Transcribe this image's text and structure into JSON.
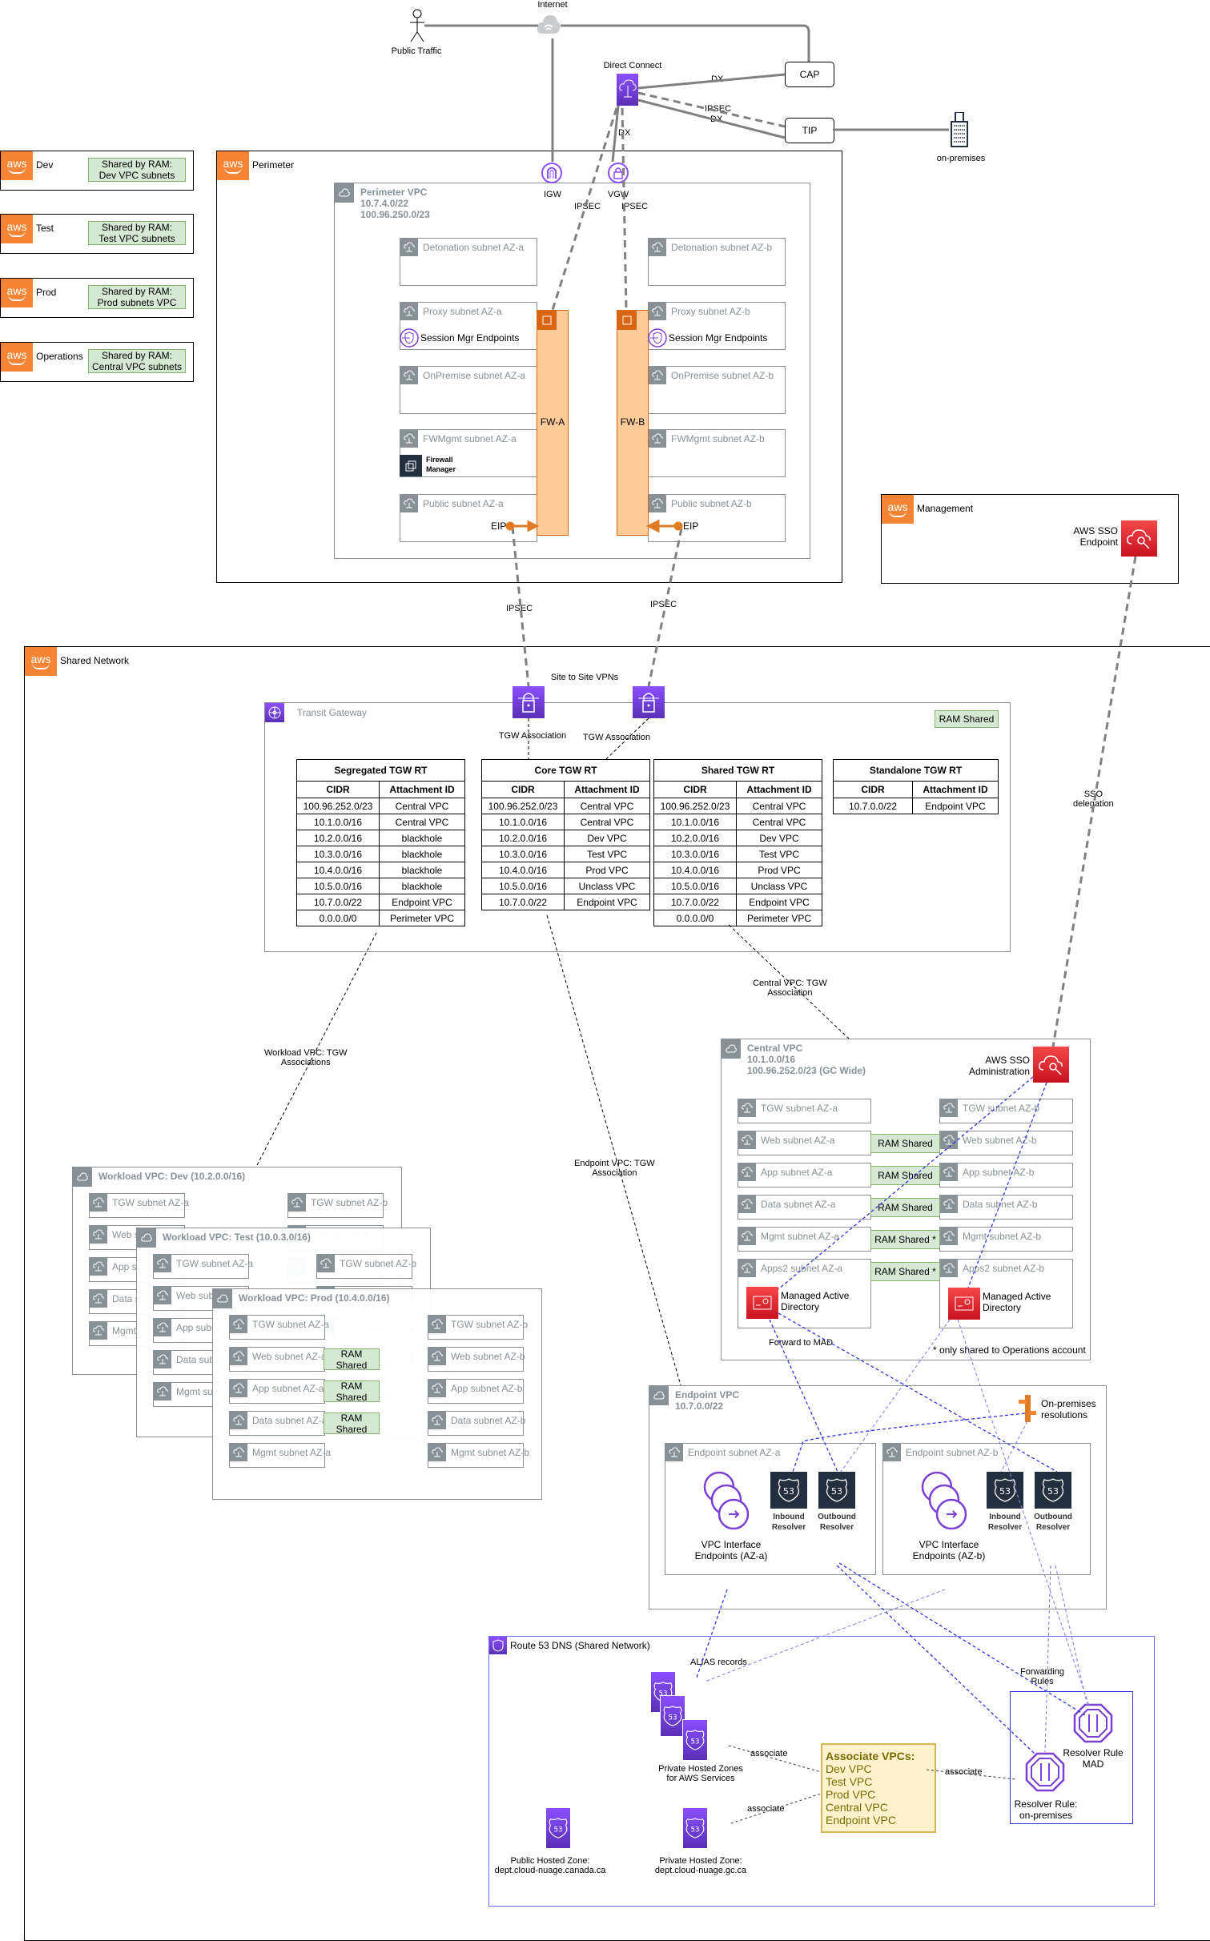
{
  "top": {
    "public_traffic": "Public Traffic",
    "internet": "Internet",
    "direct_connect": "Direct Connect",
    "cap": "CAP",
    "tip": "TIP",
    "on_premises": "on-premises",
    "dx1": "DX",
    "ipsec": "IPSEC",
    "dx2": "DX",
    "dx3": "DX",
    "igw": "IGW",
    "vgw": "VGW",
    "ipsec_a": "IPSEC",
    "ipsec_b": "IPSEC"
  },
  "accounts": [
    {
      "name": "Dev",
      "ram": "Shared by RAM:\nDev VPC subnets"
    },
    {
      "name": "Test",
      "ram": "Shared by RAM:\nTest VPC subnets"
    },
    {
      "name": "Prod",
      "ram": "Shared by RAM:\nProd subnets VPC"
    },
    {
      "name": "Operations",
      "ram": "Shared by RAM:\nCentral VPC subnets"
    }
  ],
  "aws_logo": "aws",
  "perimeter": {
    "account": "Perimeter",
    "vpc_title": "Perimeter VPC\n10.7.4.0/22\n100.96.250.0/23",
    "subnets_a": [
      "Detonation subnet AZ-a",
      "Proxy subnet AZ-a",
      "OnPremise subnet AZ-a",
      "FWMgmt subnet AZ-a",
      "Public subnet AZ-a"
    ],
    "subnets_b": [
      "Detonation subnet AZ-b",
      "Proxy subnet AZ-b",
      "OnPremise subnet AZ-b",
      "FWMgmt subnet AZ-b",
      "Public subnet AZ-b"
    ],
    "session_mgr": "Session Mgr Endpoints",
    "firewall_manager": "Firewall\nManager",
    "fw_a": "FW-A",
    "fw_b": "FW-B",
    "eip": "EIP",
    "ipsec_down": "IPSEC"
  },
  "management": {
    "account": "Management",
    "sso_endpoint": "AWS SSO\nEndpoint",
    "sso_delegation": "SSO\ndelegation"
  },
  "shared_network": {
    "account": "Shared Network",
    "site_to_site": "Site to Site VPNs",
    "tgw_association": "TGW Association",
    "transit_gateway": "Transit Gateway",
    "ram_shared": "RAM Shared",
    "route_tables": [
      {
        "title": "Segregated TGW RT",
        "headers": [
          "CIDR",
          "Attachment ID"
        ],
        "rows": [
          [
            "100.96.252.0/23",
            "Central VPC"
          ],
          [
            "10.1.0.0/16",
            "Central VPC"
          ],
          [
            "10.2.0.0/16",
            "blackhole"
          ],
          [
            "10.3.0.0/16",
            "blackhole"
          ],
          [
            "10.4.0.0/16",
            "blackhole"
          ],
          [
            "10.5.0.0/16",
            "blackhole"
          ],
          [
            "10.7.0.0/22",
            "Endpoint VPC"
          ],
          [
            "0.0.0.0/0",
            "Perimeter VPC"
          ]
        ]
      },
      {
        "title": "Core TGW RT",
        "headers": [
          "CIDR",
          "Attachment ID"
        ],
        "rows": [
          [
            "100.96.252.0/23",
            "Central VPC"
          ],
          [
            "10.1.0.0/16",
            "Central VPC"
          ],
          [
            "10.2.0.0/16",
            "Dev VPC"
          ],
          [
            "10.3.0.0/16",
            "Test VPC"
          ],
          [
            "10.4.0.0/16",
            "Prod VPC"
          ],
          [
            "10.5.0.0/16",
            "Unclass VPC"
          ],
          [
            "10.7.0.0/22",
            "Endpoint VPC"
          ]
        ]
      },
      {
        "title": "Shared TGW RT",
        "headers": [
          "CIDR",
          "Attachment ID"
        ],
        "rows": [
          [
            "100.96.252.0/23",
            "Central VPC"
          ],
          [
            "10.1.0.0/16",
            "Central VPC"
          ],
          [
            "10.2.0.0/16",
            "Dev VPC"
          ],
          [
            "10.3.0.0/16",
            "Test VPC"
          ],
          [
            "10.4.0.0/16",
            "Prod VPC"
          ],
          [
            "10.5.0.0/16",
            "Unclass VPC"
          ],
          [
            "10.7.0.0/22",
            "Endpoint VPC"
          ],
          [
            "0.0.0.0/0",
            "Perimeter VPC"
          ]
        ]
      },
      {
        "title": "Standalone TGW RT",
        "headers": [
          "CIDR",
          "Attachment ID"
        ],
        "rows": [
          [
            "10.7.0.0/22",
            "Endpoint VPC"
          ]
        ]
      }
    ],
    "workload_assoc": "Workload VPC: TGW\nAssociations",
    "endpoint_assoc": "Endpoint VPC: TGW\nAssociation",
    "central_assoc": "Central VPC: TGW\nAssociation"
  },
  "workloads": [
    {
      "title": "Workload VPC: Dev (10.2.0.0/16)"
    },
    {
      "title": "Workload VPC: Test (10.0.3.0/16)"
    },
    {
      "title": "Workload VPC: Prod (10.4.0.0/16)"
    }
  ],
  "workload_subnets_a": [
    "TGW subnet AZ-a",
    "Web subnet AZ-a",
    "App subnet AZ-a",
    "Data subnet AZ-a",
    "Mgmt subnet AZ-a"
  ],
  "workload_subnets_b": [
    "TGW subnet AZ-b",
    "Web subnet AZ-b",
    "App subnet AZ-b",
    "Data subnet AZ-b",
    "Mgmt subnet AZ-b"
  ],
  "central": {
    "title": "Central VPC\n10.1.0.0/16\n100.96.252.0/23 (GC Wide)",
    "sso_admin": "AWS SSO\nAdministration",
    "subnets_a": [
      "TGW subnet AZ-a",
      "Web subnet AZ-a",
      "App subnet AZ-a",
      "Data subnet AZ-a",
      "Mgmt subnet AZ-a",
      "Apps2 subnet AZ-a"
    ],
    "subnets_b": [
      "TGW subnet AZ-b",
      "Web subnet AZ-b",
      "App subnet AZ-b",
      "Data subnet AZ-b",
      "Mgmt subnet AZ-b",
      "Apps2 subnet AZ-b"
    ],
    "ram_labels": [
      "RAM Shared",
      "RAM Shared",
      "RAM Shared",
      "RAM Shared *",
      "RAM Shared *"
    ],
    "mad": "Managed Active\nDirectory",
    "forward_to_mad": "Forward to MAD",
    "footnote": "* only shared to Operations account"
  },
  "endpoint": {
    "title": "Endpoint VPC\n10.7.0.0/22",
    "onprem_res": "On-premises\nresolutions",
    "subnet_a": "Endpoint subnet AZ-a",
    "subnet_b": "Endpoint subnet AZ-b",
    "vpce_a": "VPC Interface\nEndpoints (AZ-a)",
    "vpce_b": "VPC Interface\nEndpoints (AZ-b)",
    "inbound": "Inbound\nResolver",
    "outbound": "Outbound\nResolver",
    "r53_num": "53"
  },
  "route53": {
    "title": "Route 53 DNS (Shared Network)",
    "alias": "ALIAS records",
    "forwarding": "Forwarding\nRules",
    "phz_aws": "Private Hosted Zones\nfor AWS Services",
    "public_zone": "Public Hosted Zone:\ndept.cloud-nuage.canada.ca",
    "private_zone": "Private Hosted Zone:\ndept.cloud-nuage.gc.ca",
    "associate": "associate",
    "note_title": "Associate VPCs:",
    "note_items": [
      "Dev VPC",
      "Test VPC",
      "Prod VPC",
      "Central VPC",
      "Endpoint VPC"
    ],
    "rule_mad": "Resolver Rule\nMAD",
    "rule_onprem": "Resolver Rule:\non-premises"
  }
}
